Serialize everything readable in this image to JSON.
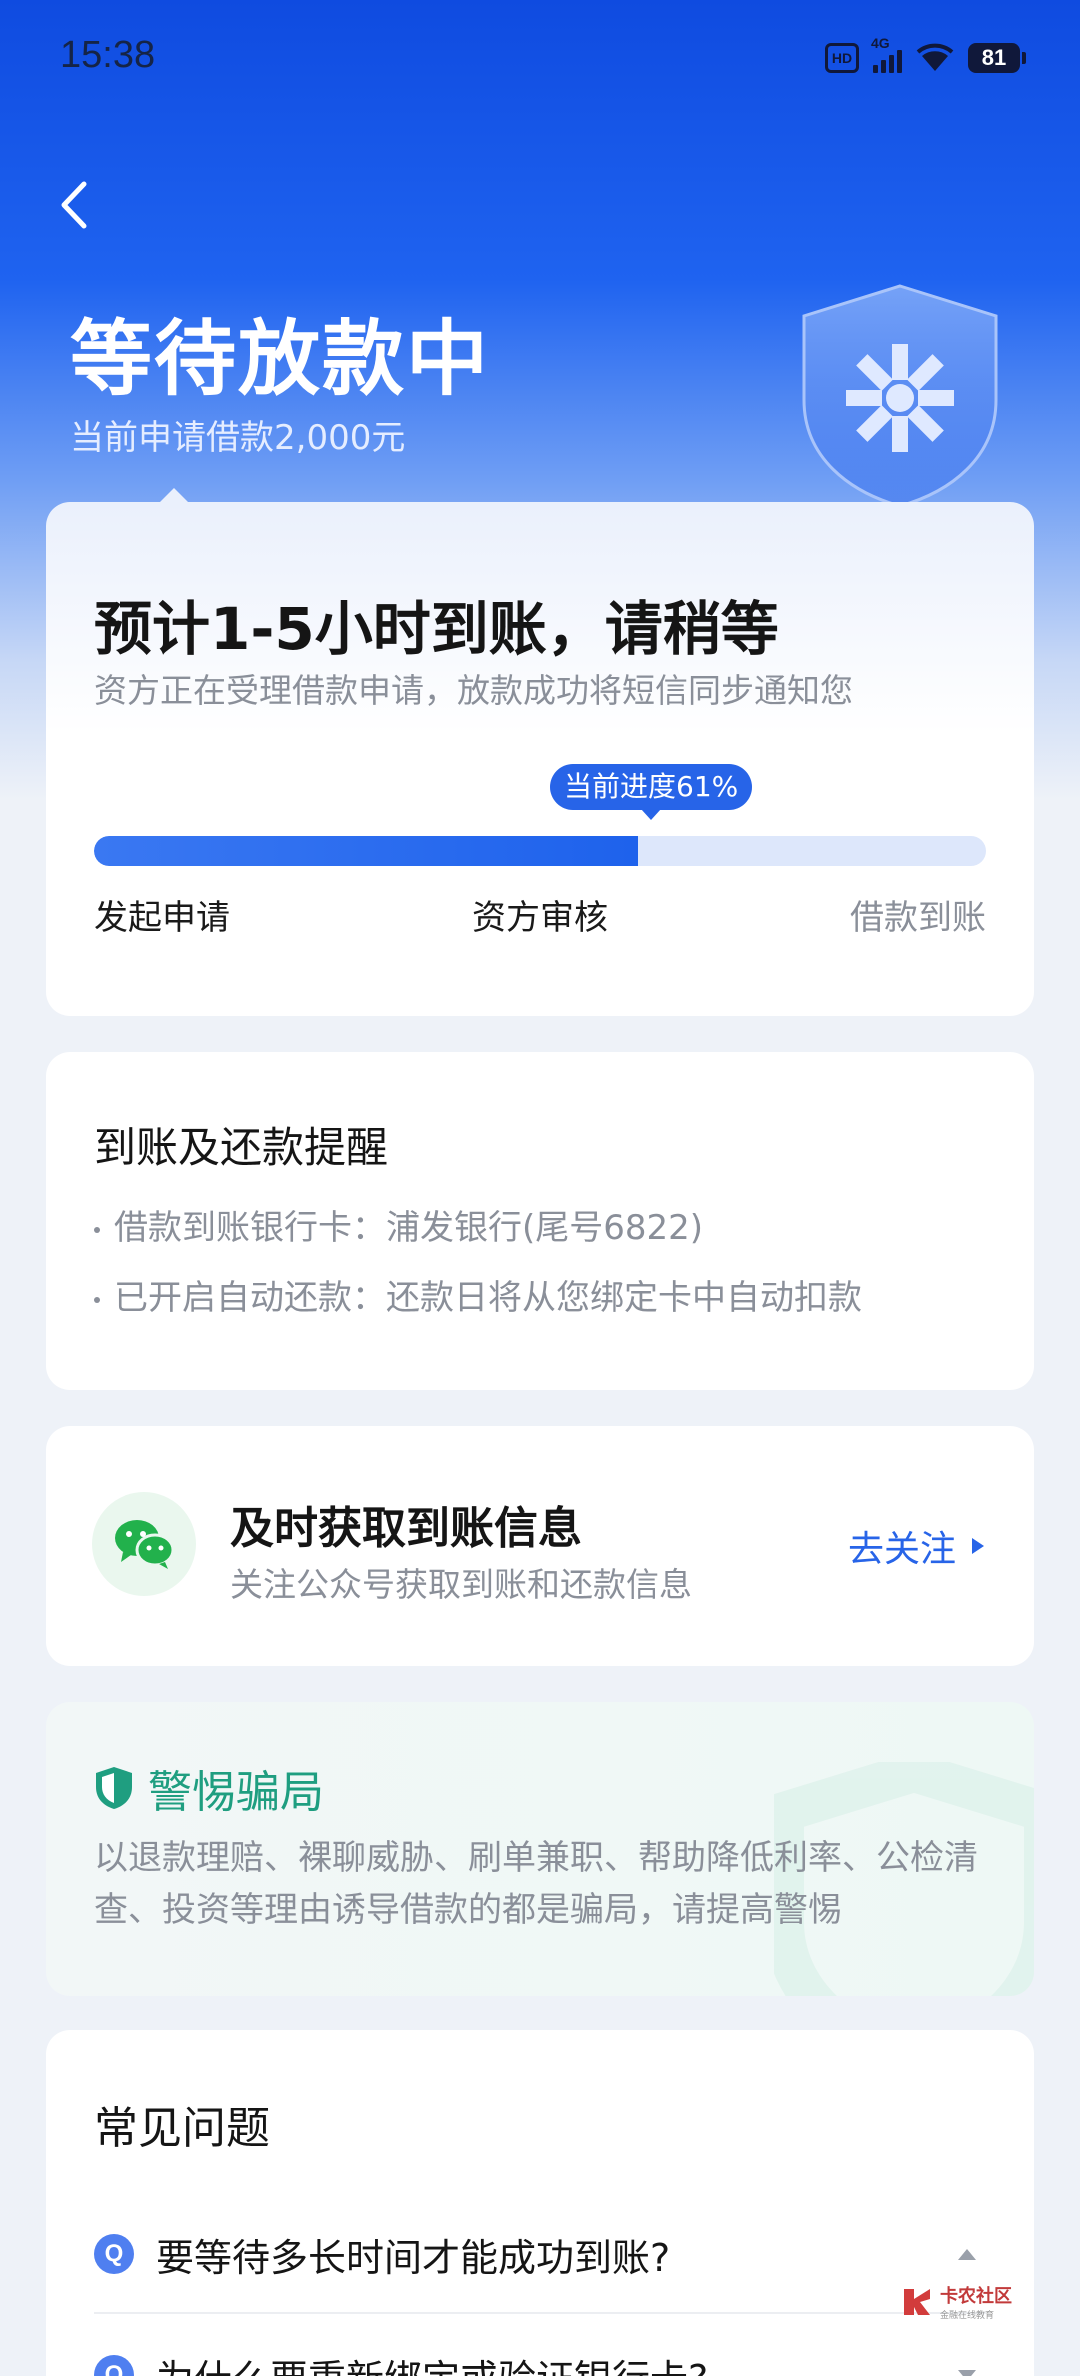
{
  "status_bar": {
    "time": "15:38",
    "hd": "HD",
    "network": "4G",
    "battery": "81"
  },
  "header": {
    "back_icon": "chevron-left-icon",
    "title": "等待放款中",
    "subtitle": "当前申请借款2,000元"
  },
  "progress": {
    "title": "预计1-5小时到账，请稍等",
    "subtitle": "资方正在受理借款申请，放款成功将短信同步通知您",
    "tip": "当前进度61%",
    "value_percent": 61,
    "steps": [
      "发起申请",
      "资方审核",
      "借款到账"
    ],
    "colors": {
      "fill": "#2764e8",
      "track": "#dde7fb"
    }
  },
  "reminder": {
    "title": "到账及还款提醒",
    "lines": [
      "借款到账银行卡：浦发银行(尾号6822)",
      "已开启自动还款：还款日将从您绑定卡中自动扣款"
    ]
  },
  "wechat": {
    "icon": "wechat-icon",
    "title": "及时获取到账信息",
    "subtitle": "关注公众号获取到账和还款信息",
    "action": "去关注"
  },
  "warning": {
    "icon": "shield-icon",
    "title": "警惕骗局",
    "text": "以退款理赔、裸聊威胁、刷单兼职、帮助降低利率、公检清查、投资等理由诱导借款的都是骗局，请提高警惕",
    "accent": "#1f9e80"
  },
  "faq": {
    "title": "常见问题",
    "badge": "Q",
    "items": [
      "要等待多长时间才能成功到账?",
      "为什么要重新绑定或验证银行卡?"
    ]
  },
  "watermark": {
    "name": "卡农社区",
    "sub": "金融在线教育"
  }
}
